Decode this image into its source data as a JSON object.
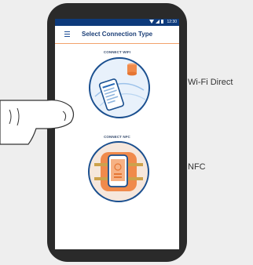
{
  "status_bar": {
    "time": "12:30"
  },
  "app_bar": {
    "title": "Select Connection Type"
  },
  "options": [
    {
      "label": "CONNECT WIFI",
      "side_label": "Wi-Fi Direct"
    },
    {
      "label": "CONNECT NFC",
      "side_label": "NFC"
    }
  ],
  "colors": {
    "status_bar": "#0d3a7b",
    "accent_orange": "#f08a4b",
    "circle_border": "#1a4f8f"
  },
  "icons": [
    "wifi-icon",
    "signal-icon",
    "battery-icon",
    "menu-icon",
    "hand-icon"
  ]
}
